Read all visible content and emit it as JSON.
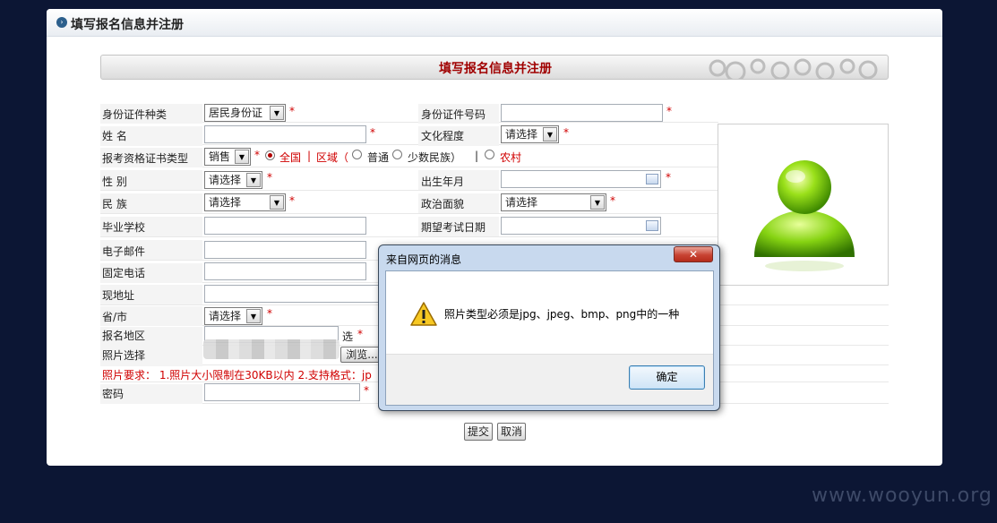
{
  "panel": {
    "title": "填写报名信息并注册"
  },
  "banner": {
    "title": "填写报名信息并注册"
  },
  "form": {
    "id_type_label": "身份证件种类",
    "id_type_value": "居民身份证",
    "id_number_label": "身份证件号码",
    "name_label": "姓  名",
    "education_label": "文化程度",
    "education_value": "请选择",
    "cert_type_label": "报考资格证书类型",
    "cert_type_value": "销售",
    "scope_national": "全国",
    "scope_region": "区域（",
    "radio_normal": "普通",
    "radio_minority": "少数民族）",
    "scope_rural": "农村",
    "gender_label": "性  别",
    "gender_value": "请选择",
    "birth_label": "出生年月",
    "ethnic_label": "民  族",
    "ethnic_value": "请选择",
    "politics_label": "政治面貌",
    "politics_value": "请选择",
    "school_label": "毕业学校",
    "exam_date_label": "期望考试日期",
    "email_label": "电子邮件",
    "phone_label": "固定电话",
    "address_label": "现地址",
    "province_label": "省/市",
    "province_value": "请选择",
    "region_label": "报名地区",
    "region_select_text": "选",
    "photo_label": "照片选择",
    "browse_label": "浏览...",
    "photo_note": "照片要求：  1.照片大小限制在30KB以内  2.支持格式：jp",
    "password_label": "密码",
    "required_mark": "*",
    "pipe": "|"
  },
  "actions": {
    "submit_label": "提交",
    "cancel_label": "取消"
  },
  "dialog": {
    "title": "来自网页的消息",
    "close_label": "✕",
    "message": "照片类型必须是jpg、jpeg、bmp、png中的一种",
    "ok_label": "确定"
  },
  "watermark": "www.wooyun.org",
  "colors": {
    "required": "#d00000",
    "banner_title": "#a00000",
    "background": "#0c1634"
  },
  "icons": {
    "panel": "bullet-circle-icon",
    "avatar": "green-user-avatar-icon",
    "calendar": "calendar-icon",
    "warning": "warning-triangle-icon"
  }
}
